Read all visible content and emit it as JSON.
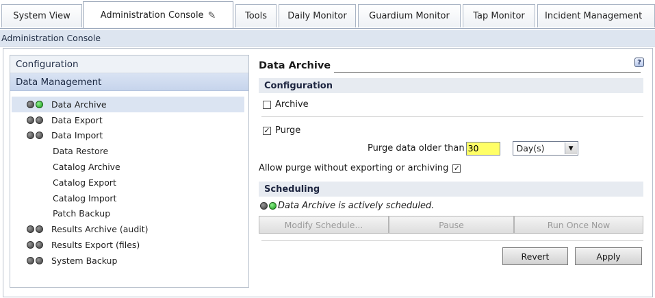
{
  "tabs": [
    {
      "label": "System View",
      "active": false
    },
    {
      "label": "Administration Console",
      "active": true,
      "icon": "pencil-icon"
    },
    {
      "label": "Tools",
      "active": false
    },
    {
      "label": "Daily Monitor",
      "active": false
    },
    {
      "label": "Guardium Monitor",
      "active": false
    },
    {
      "label": "Tap Monitor",
      "active": false
    },
    {
      "label": "Incident Management",
      "active": false
    }
  ],
  "breadcrumb": "Administration Console",
  "nav": {
    "sections": [
      "Configuration",
      "Data Management"
    ],
    "items": [
      {
        "label": "Data Archive",
        "status": "active",
        "selected": true
      },
      {
        "label": "Data Export",
        "status": "inactive"
      },
      {
        "label": "Data Import",
        "status": "inactive"
      },
      {
        "label": "Data Restore"
      },
      {
        "label": "Catalog Archive"
      },
      {
        "label": "Catalog Export"
      },
      {
        "label": "Catalog Import"
      },
      {
        "label": "Patch Backup"
      },
      {
        "label": "Results Archive (audit)",
        "status": "inactive"
      },
      {
        "label": "Results Export (files)",
        "status": "inactive"
      },
      {
        "label": "System Backup",
        "status": "inactive"
      }
    ]
  },
  "main": {
    "title": "Data Archive",
    "help": "?",
    "configuration_header": "Configuration",
    "archive_label": "Archive",
    "archive_checked": false,
    "purge_label": "Purge",
    "purge_checked": true,
    "purge_older_label": "Purge data older than",
    "purge_older_value": "30",
    "purge_unit": "Day(s)",
    "allow_purge_label": "Allow purge without exporting or archiving",
    "allow_purge_checked": true,
    "scheduling_header": "Scheduling",
    "schedule_status": "Data Archive is actively scheduled.",
    "buttons": {
      "modify_schedule": "Modify Schedule...",
      "pause": "Pause",
      "run_once_now": "Run Once Now",
      "revert": "Revert",
      "apply": "Apply"
    }
  },
  "colors": {
    "accent": "#c6d4ec",
    "highlight_input": "#ffff66",
    "status_active": "#2ecc40",
    "status_inactive": "#555555"
  }
}
